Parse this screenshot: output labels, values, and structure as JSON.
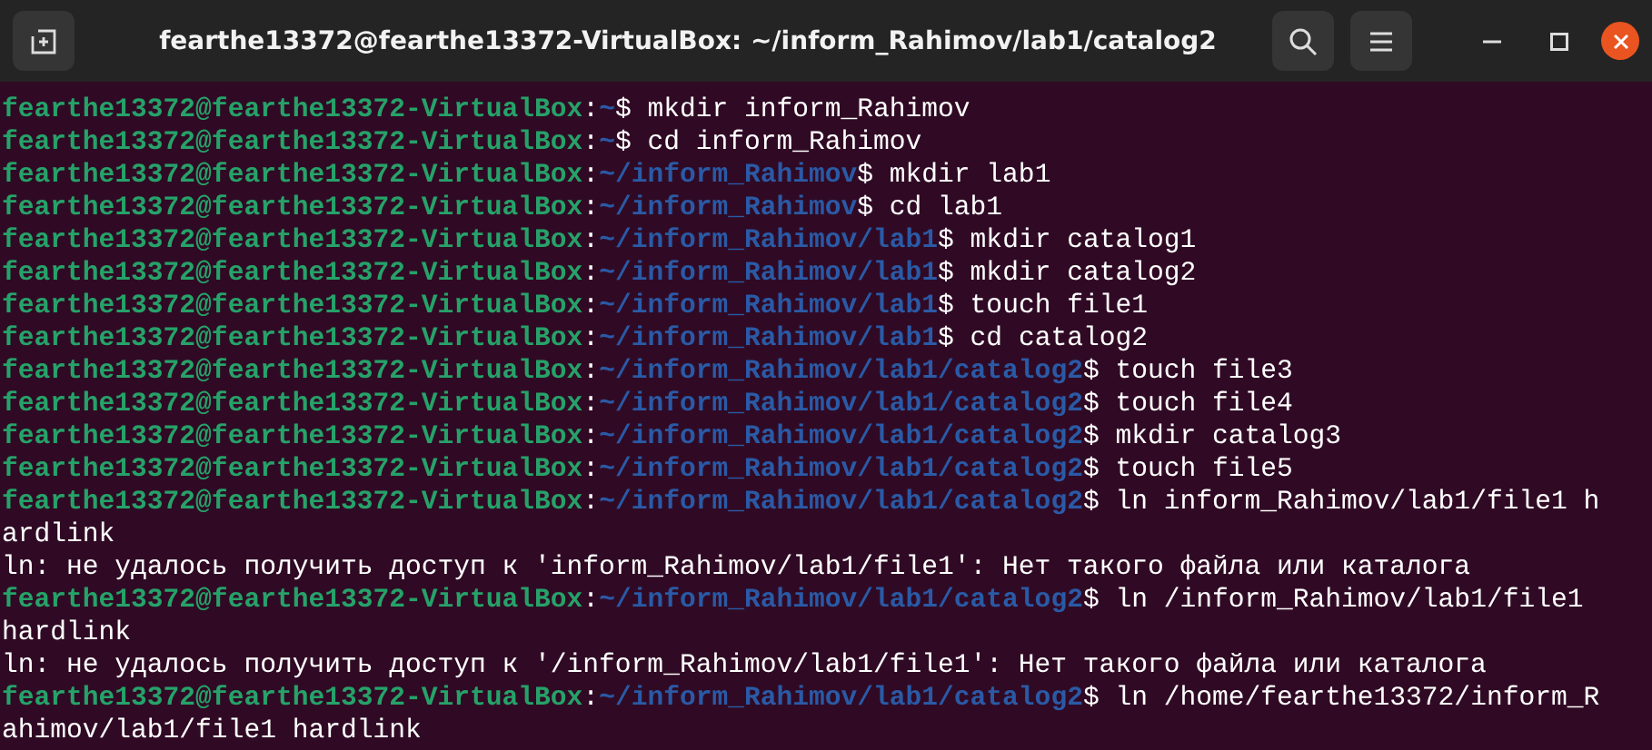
{
  "window": {
    "title": "fearthe13372@fearthe13372-VirtualBox: ~/inform_Rahimov/lab1/catalog2"
  },
  "terminal": {
    "lines": [
      {
        "kind": "prompt",
        "user": "fearthe13372@fearthe13372-VirtualBox",
        "separator": ":",
        "path": "~",
        "command": "$ mkdir inform_Rahimov"
      },
      {
        "kind": "prompt",
        "user": "fearthe13372@fearthe13372-VirtualBox",
        "separator": ":",
        "path": "~",
        "command": "$ cd inform_Rahimov"
      },
      {
        "kind": "prompt",
        "user": "fearthe13372@fearthe13372-VirtualBox",
        "separator": ":",
        "path": "~/inform_Rahimov",
        "command": "$ mkdir lab1"
      },
      {
        "kind": "prompt",
        "user": "fearthe13372@fearthe13372-VirtualBox",
        "separator": ":",
        "path": "~/inform_Rahimov",
        "command": "$ cd lab1"
      },
      {
        "kind": "prompt",
        "user": "fearthe13372@fearthe13372-VirtualBox",
        "separator": ":",
        "path": "~/inform_Rahimov/lab1",
        "command": "$ mkdir catalog1"
      },
      {
        "kind": "prompt",
        "user": "fearthe13372@fearthe13372-VirtualBox",
        "separator": ":",
        "path": "~/inform_Rahimov/lab1",
        "command": "$ mkdir catalog2"
      },
      {
        "kind": "prompt",
        "user": "fearthe13372@fearthe13372-VirtualBox",
        "separator": ":",
        "path": "~/inform_Rahimov/lab1",
        "command": "$ touch file1"
      },
      {
        "kind": "prompt",
        "user": "fearthe13372@fearthe13372-VirtualBox",
        "separator": ":",
        "path": "~/inform_Rahimov/lab1",
        "command": "$ cd catalog2"
      },
      {
        "kind": "prompt",
        "user": "fearthe13372@fearthe13372-VirtualBox",
        "separator": ":",
        "path": "~/inform_Rahimov/lab1/catalog2",
        "command": "$ touch file3"
      },
      {
        "kind": "prompt",
        "user": "fearthe13372@fearthe13372-VirtualBox",
        "separator": ":",
        "path": "~/inform_Rahimov/lab1/catalog2",
        "command": "$ touch file4"
      },
      {
        "kind": "prompt",
        "user": "fearthe13372@fearthe13372-VirtualBox",
        "separator": ":",
        "path": "~/inform_Rahimov/lab1/catalog2",
        "command": "$ mkdir catalog3"
      },
      {
        "kind": "prompt",
        "user": "fearthe13372@fearthe13372-VirtualBox",
        "separator": ":",
        "path": "~/inform_Rahimov/lab1/catalog2",
        "command": "$ touch file5"
      },
      {
        "kind": "prompt",
        "user": "fearthe13372@fearthe13372-VirtualBox",
        "separator": ":",
        "path": "~/inform_Rahimov/lab1/catalog2",
        "command": "$ ln inform_Rahimov/lab1/file1 h"
      },
      {
        "kind": "output",
        "text": "ardlink"
      },
      {
        "kind": "output",
        "text": "ln: не удалось получить доступ к 'inform_Rahimov/lab1/file1': Нет такого файла или каталога"
      },
      {
        "kind": "prompt",
        "user": "fearthe13372@fearthe13372-VirtualBox",
        "separator": ":",
        "path": "~/inform_Rahimov/lab1/catalog2",
        "command": "$ ln /inform_Rahimov/lab1/file1"
      },
      {
        "kind": "output",
        "text": "hardlink"
      },
      {
        "kind": "output",
        "text": "ln: не удалось получить доступ к '/inform_Rahimov/lab1/file1': Нет такого файла или каталога"
      },
      {
        "kind": "prompt",
        "user": "fearthe13372@fearthe13372-VirtualBox",
        "separator": ":",
        "path": "~/inform_Rahimov/lab1/catalog2",
        "command": "$ ln /home/fearthe13372/inform_R"
      },
      {
        "kind": "output",
        "text": "ahimov/lab1/file1 hardlink"
      }
    ]
  }
}
